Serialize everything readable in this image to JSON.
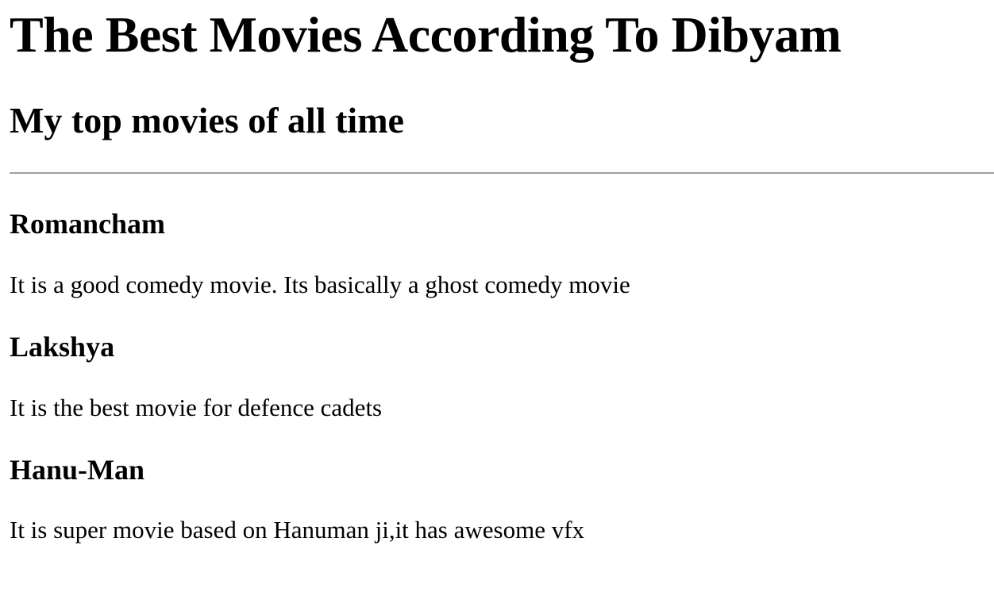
{
  "page": {
    "title": "The Best Movies According To Dibyam",
    "subtitle": "My top movies of all time"
  },
  "movies": [
    {
      "title": "Romancham",
      "description": "It is a good comedy movie. Its basically a ghost comedy movie"
    },
    {
      "title": "Lakshya",
      "description": "It is the best movie for defence cadets"
    },
    {
      "title": "Hanu-Man",
      "description": "It is super movie based on Hanuman ji,it has awesome vfx"
    }
  ]
}
